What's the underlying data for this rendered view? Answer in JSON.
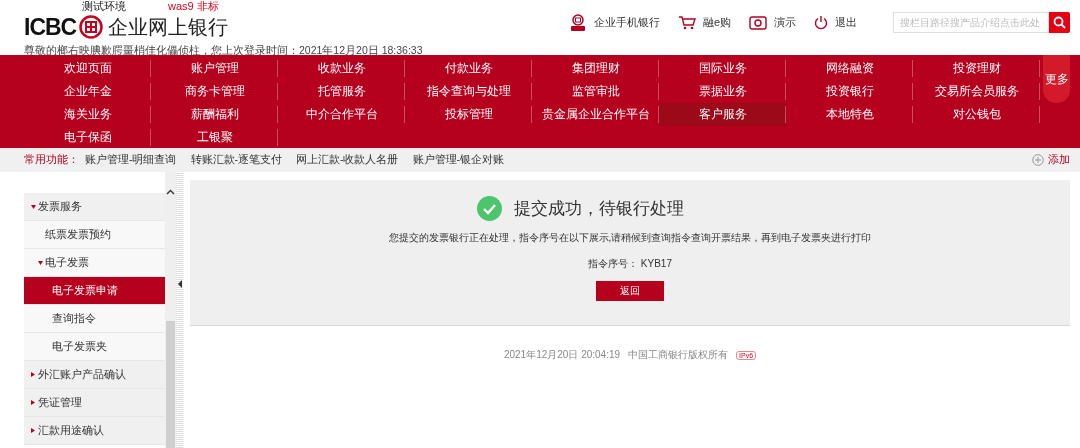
{
  "header": {
    "logo_text": "ICBC",
    "title": "企业网上银行",
    "env_label": "测试环境",
    "version_label": "was9 非标",
    "welcome": "尊敬的榔右映腆歉腭畺梢佳化儡侦柱，您上次登录时间：2021年12月20日 18:36:33",
    "links": [
      {
        "label": "企业手机银行",
        "kind": "mobile"
      },
      {
        "label": "融e购",
        "kind": "cart"
      },
      {
        "label": "演示",
        "kind": "demo"
      },
      {
        "label": "退出",
        "kind": "power"
      }
    ],
    "search": {
      "placeholder": "搜栏目路径搜产品介绍点击此处"
    }
  },
  "nav": {
    "rows": [
      [
        {
          "label": "欢迎页面",
          "selected": false
        },
        {
          "label": "账户管理",
          "selected": false
        },
        {
          "label": "收款业务",
          "selected": false
        },
        {
          "label": "付款业务",
          "selected": false
        },
        {
          "label": "集团理财",
          "selected": false
        },
        {
          "label": "国际业务",
          "selected": false
        },
        {
          "label": "网络融资",
          "selected": false
        },
        {
          "label": "投资理财",
          "selected": false
        }
      ],
      [
        {
          "label": "企业年金",
          "selected": false
        },
        {
          "label": "商务卡管理",
          "selected": false
        },
        {
          "label": "托管服务",
          "selected": false
        },
        {
          "label": "指令查询与处理",
          "selected": false
        },
        {
          "label": "监管审批",
          "selected": false
        },
        {
          "label": "票据业务",
          "selected": false
        },
        {
          "label": "投资银行",
          "selected": false
        },
        {
          "label": "交易所会员服务",
          "selected": false
        }
      ],
      [
        {
          "label": "海关业务",
          "selected": false
        },
        {
          "label": "薪酬福利",
          "selected": false
        },
        {
          "label": "中介合作平台",
          "selected": false
        },
        {
          "label": "投标管理",
          "selected": false
        },
        {
          "label": "贵金属企业合作平台",
          "selected": false
        },
        {
          "label": "客户服务",
          "selected": true
        },
        {
          "label": "本地特色",
          "selected": false
        },
        {
          "label": "对公钱包",
          "selected": false
        }
      ],
      [
        {
          "label": "电子保函",
          "selected": false
        },
        {
          "label": "工银聚",
          "selected": false
        }
      ]
    ],
    "more": "更多"
  },
  "shortcuts": {
    "label": "常用功能：",
    "items": [
      "账户管理-明细查询",
      "转账汇款-逐笔支付",
      "网上汇款-收款人名册",
      "账户管理-银企对账"
    ],
    "add": "添加"
  },
  "sidebar": {
    "items": [
      {
        "label": "发票服务",
        "expanded": true,
        "children": [
          {
            "label": "纸票发票预约",
            "selected": false
          },
          {
            "label": "电子发票",
            "expanded": true,
            "children": [
              {
                "label": "电子发票申请",
                "selected": true
              },
              {
                "label": "查询指令",
                "selected": false
              },
              {
                "label": "电子发票夹",
                "selected": false
              }
            ]
          }
        ]
      },
      {
        "label": "外汇账户产品确认",
        "expanded": false
      },
      {
        "label": "凭证管理",
        "expanded": false
      },
      {
        "label": "汇款用途确认",
        "expanded": false
      }
    ]
  },
  "result": {
    "title": "提交成功，待银行处理",
    "message": "您提交的发票银行正在处理，指令序号在以下展示,请稍候到查询指令查询开票结果，再到电子发票夹进行打印",
    "serial_label": "指令序号：",
    "serial": "KYB17",
    "button": "返回"
  },
  "footer": {
    "time": "2021年12月20日 20:04:19",
    "copyright": "中国工商银行版权所有",
    "badge": "IPv6"
  }
}
